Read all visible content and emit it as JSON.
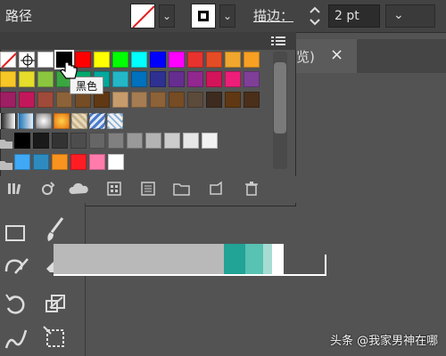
{
  "control_bar": {
    "path_label": "路径",
    "stroke_label": "描边：",
    "stroke_weight": "2 pt",
    "fill_dropdown_glyph": "⌄",
    "stroke_dropdown_glyph": "⌄",
    "unit_dropdown_glyph": "⌄"
  },
  "document_tab": {
    "title_fragment": "览)",
    "close_glyph": "×"
  },
  "swatches_panel": {
    "menu_icon": "panel-menu-icon",
    "tooltip": "黑色",
    "row1": [
      "none",
      "registration",
      "#ffffff",
      "#000000",
      "#ff0000",
      "#ffff00",
      "#00ff00",
      "#00ffff",
      "#0000ff",
      "#ff00ff",
      "#e8322e",
      "#e44c25",
      "#f1a72d",
      "#f8a024"
    ],
    "row2": [
      "#f7c627",
      "#e5dd2a",
      "#8cc63f",
      "#3aa640",
      "#00a86b",
      "#00a99d",
      "#23b7c8",
      "#0071bc",
      "#2e3192",
      "#662d91",
      "#92278f",
      "#d4145a",
      "#ed1e79",
      "#7f3f98"
    ],
    "row3": [
      "#9e1f63",
      "#c2185b",
      "#a04a3a",
      "#8c6239",
      "#754c24",
      "#603813",
      "#c69c6d",
      "#a67c52",
      "#8c6239",
      "#754c24",
      "#5c4a3a",
      "#3d2b1f",
      "#603813",
      "#4a2f1a"
    ],
    "row5": [
      "#000000",
      "#1a1a1a",
      "#333333",
      "#4d4d4d",
      "#666666",
      "#808080",
      "#999999",
      "#b3b3b3",
      "#cccccc",
      "#e6e6e6",
      "#f2f2f2"
    ],
    "row6": [
      "#3fa9f5",
      "#2e8bc0",
      "#f7931e",
      "#ff1d25",
      "#ff7bac",
      "#ffffff"
    ],
    "footer_icons": [
      "swatch-library-icon",
      "place-swatch-icon",
      "cloud-library-icon",
      "swatch-kind-icon",
      "color-group-icon",
      "new-color-group-icon",
      "new-swatch-icon",
      "delete-swatch-icon"
    ]
  },
  "gradient_bar": {
    "stops": [
      "#b9b9b9",
      "#b9b9b9",
      "#21a396",
      "#58c2b3",
      "#a6dcd3",
      "#ffffff"
    ]
  },
  "watermark": "头条 @我家男神在哪"
}
